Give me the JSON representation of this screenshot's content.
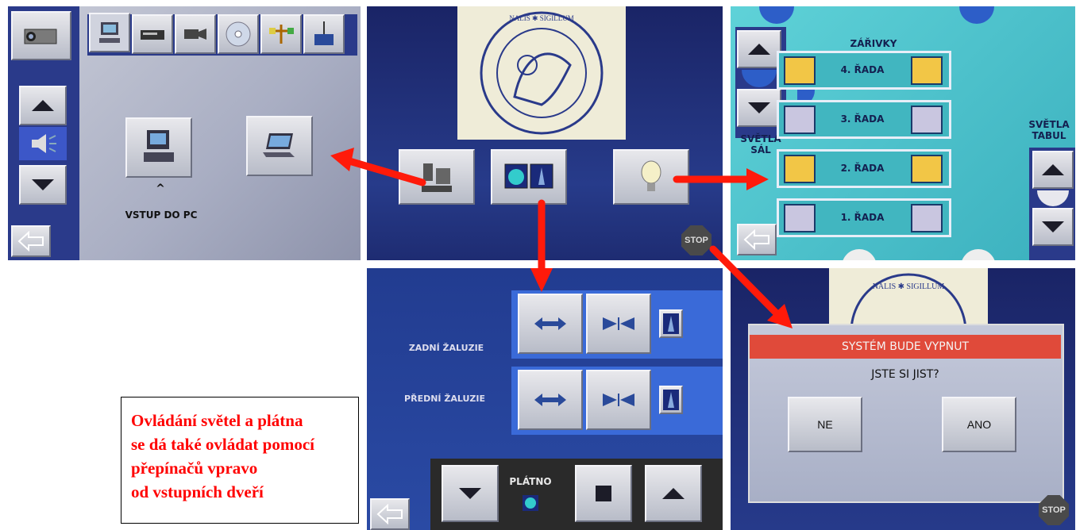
{
  "panel_pc": {
    "tabs": [
      "monitor-tab",
      "vcr-tab",
      "camera-tab",
      "cd-tab",
      "network-tab",
      "antenna-tab"
    ],
    "vstup_label": "VSTUP DO PC",
    "caret": "^",
    "volume": "speaker-icon"
  },
  "panel_main": {
    "seal_text": "SIGILLUM UNIVERSITATIS MORAVICAE BOHEMIAE MERIDIONALIS",
    "stop": "STOP"
  },
  "panel_lights": {
    "header": "ZÁŘIVKY",
    "left_label": "SVĚTLA\nSÁL",
    "right_label": "SVĚTLA\nTABUL",
    "rows": [
      {
        "label": "4. ŘADA",
        "state": "on"
      },
      {
        "label": "3. ŘADA",
        "state": "off"
      },
      {
        "label": "2. ŘADA",
        "state": "on"
      },
      {
        "label": "1. ŘADA",
        "state": "off"
      }
    ]
  },
  "panel_blinds": {
    "rear_label": "ZADNÍ ŽALUZIE",
    "front_label": "PŘEDNÍ ŽALUZIE",
    "screen_label": "PLÁTNO"
  },
  "panel_shutdown": {
    "title": "SYSTÉM BUDE VYPNUT",
    "question": "JSTE SI JIST?",
    "no": "NE",
    "yes": "ANO",
    "stop": "STOP"
  },
  "note": {
    "lines": [
      "Ovládání světel a plátna",
      "se dá také ovládat pomocí",
      "přepínačů vpravo",
      "od vstupních dveří"
    ]
  },
  "colors": {
    "arrow": "#ff1a0a",
    "note_text": "#ff0000",
    "panel_blue": "#2a3a8a"
  }
}
